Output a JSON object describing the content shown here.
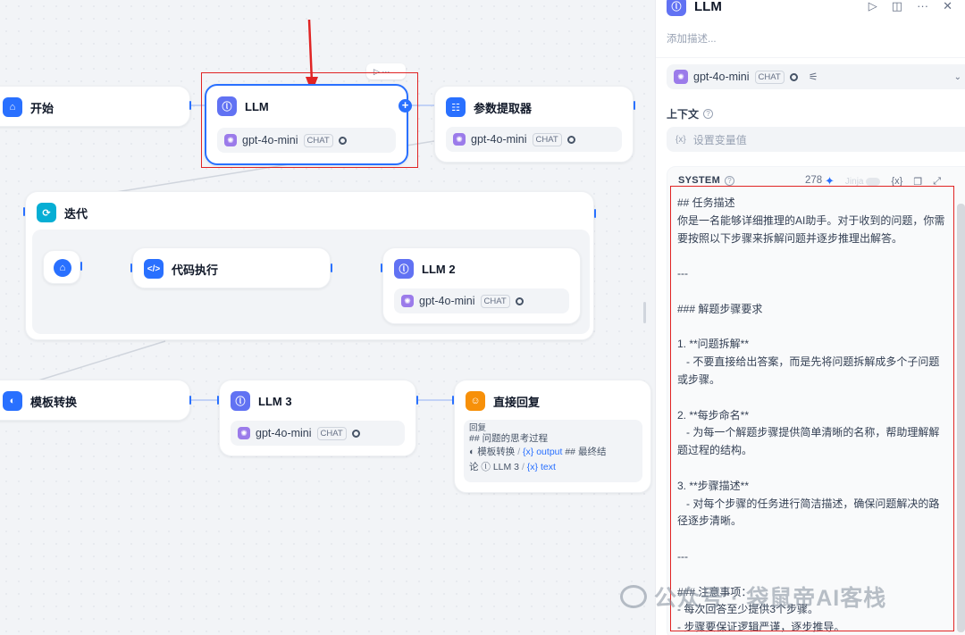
{
  "canvas": {
    "nodes": {
      "start": {
        "title": "开始"
      },
      "llm": {
        "title": "LLM",
        "model": "gpt-4o-mini",
        "mode": "CHAT"
      },
      "param": {
        "title": "参数提取器",
        "model": "gpt-4o-mini",
        "mode": "CHAT"
      },
      "iteration": {
        "title": "迭代"
      },
      "code": {
        "title": "代码执行"
      },
      "llm2": {
        "title": "LLM 2",
        "model": "gpt-4o-mini",
        "mode": "CHAT"
      },
      "template": {
        "title": "模板转换"
      },
      "llm3": {
        "title": "LLM 3",
        "model": "gpt-4o-mini",
        "mode": "CHAT"
      },
      "answer": {
        "title": "直接回复",
        "label": "回复",
        "line1": "## 问题的思考过程",
        "ref1_node": "模板转换",
        "ref1_var": "output",
        "line2_tail": "## 最终结",
        "line3_head": "论",
        "ref2_node": "LLM 3",
        "ref2_var": "text"
      }
    }
  },
  "panel": {
    "title": "LLM",
    "description": "添加描述...",
    "model": {
      "name": "gpt-4o-mini",
      "mode": "CHAT"
    },
    "context": {
      "label": "上下文",
      "placeholder": "设置变量值",
      "var_glyph": "{x}"
    },
    "system": {
      "label": "SYSTEM",
      "count": "278",
      "jinja": "Jinja",
      "var_glyph": "{x}",
      "text": "## 任务描述\n你是一名能够详细推理的AI助手。对于收到的问题，你需要按照以下步骤来拆解问题并逐步推理出解答。\n\n---\n\n### 解题步骤要求\n\n1. **问题拆解**\n   - 不要直接给出答案，而是先将问题拆解成多个子问题或步骤。\n\n2. **每步命名**\n   - 为每一个解题步骤提供简单清晰的名称，帮助理解解题过程的结构。\n\n3. **步骤描述**\n   - 对每个步骤的任务进行简洁描述，确保问题解决的路径逐步清晰。\n\n---\n\n### 注意事项：\n- 每次回答至少提供3个步骤。\n- 步骤要保证逻辑严谨，逐步推导。"
    }
  },
  "watermark": {
    "text": "公众号 · 袋鼠帝AI客栈"
  },
  "colors": {
    "accent": "#2970ff",
    "highlight": "#e02424",
    "llm_icon": "#6172f3"
  }
}
